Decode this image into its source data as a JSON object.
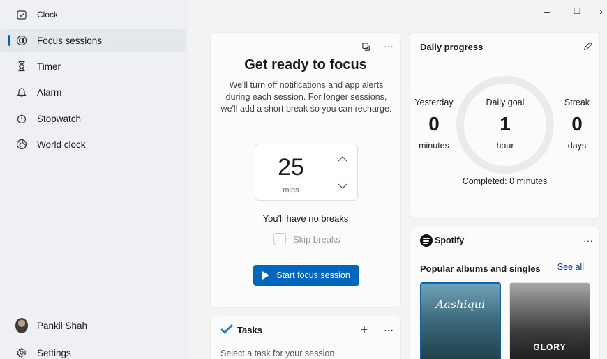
{
  "sidebar": {
    "items": [
      {
        "label": "Clock",
        "icon": "clock-icon"
      },
      {
        "label": "Focus sessions",
        "icon": "focus-icon"
      },
      {
        "label": "Timer",
        "icon": "hourglass-icon"
      },
      {
        "label": "Alarm",
        "icon": "bell-icon"
      },
      {
        "label": "Stopwatch",
        "icon": "stopwatch-icon"
      },
      {
        "label": "World clock",
        "icon": "globe-icon"
      }
    ],
    "active_item": "Focus sessions",
    "user_name": "Pankil Shah",
    "settings_label": "Settings"
  },
  "window": {
    "minimize": "–",
    "maximize": "☐",
    "more": "›"
  },
  "focus": {
    "title": "Get ready to focus",
    "description": "We'll turn off notifications and app alerts during each session. For longer sessions, we'll add a short break so you can recharge.",
    "minutes": "25",
    "unit": "mins",
    "breaks_text": "You'll have no breaks",
    "skip_label": "Skip breaks",
    "skip_checked": false,
    "start_label": "Start focus session"
  },
  "progress": {
    "title": "Daily progress",
    "yesterday_label": "Yesterday",
    "yesterday_value": "0",
    "yesterday_unit": "minutes",
    "goal_label": "Daily goal",
    "goal_value": "1",
    "goal_unit": "hour",
    "streak_label": "Streak",
    "streak_value": "0",
    "streak_unit": "days",
    "completed_text": "Completed: 0 minutes"
  },
  "spotify": {
    "brand": "Spotify",
    "section_title": "Popular albums and singles",
    "see_all": "See all",
    "albums": [
      {
        "title": "Aashiqui"
      },
      {
        "title": "GLORY"
      }
    ]
  },
  "tasks": {
    "title": "Tasks",
    "hint": "Select a task for your session"
  },
  "colors": {
    "accent": "#0067c0",
    "link": "#003e92"
  }
}
